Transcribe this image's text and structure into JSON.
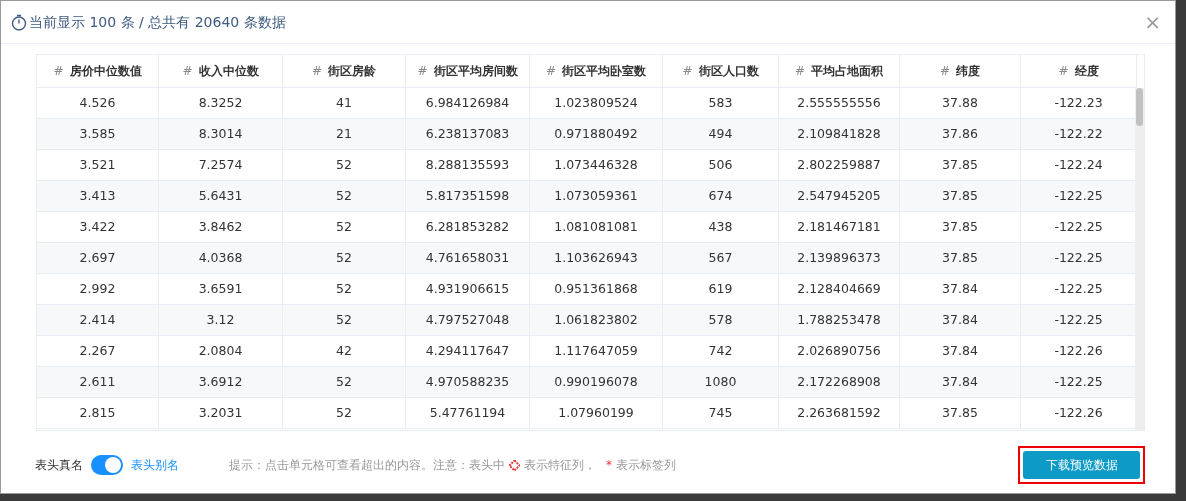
{
  "dialog": {
    "title": "当前显示 100 条 / 总共有 20640 条数据",
    "close": "×"
  },
  "table": {
    "columns": [
      {
        "mark": "#",
        "label": "房价中位数值"
      },
      {
        "mark": "#",
        "label": "收入中位数"
      },
      {
        "mark": "#",
        "label": "街区房龄"
      },
      {
        "mark": "#",
        "label": "街区平均房间数"
      },
      {
        "mark": "#",
        "label": "街区平均卧室数"
      },
      {
        "mark": "#",
        "label": "街区人口数"
      },
      {
        "mark": "#",
        "label": "平均占地面积"
      },
      {
        "mark": "#",
        "label": "纬度"
      },
      {
        "mark": "#",
        "label": "经度"
      }
    ],
    "rows": [
      [
        "4.526",
        "8.3252",
        "41",
        "6.984126984",
        "1.023809524",
        "583",
        "2.555555556",
        "37.88",
        "-122.23"
      ],
      [
        "3.585",
        "8.3014",
        "21",
        "6.238137083",
        "0.971880492",
        "494",
        "2.109841828",
        "37.86",
        "-122.22"
      ],
      [
        "3.521",
        "7.2574",
        "52",
        "8.288135593",
        "1.073446328",
        "506",
        "2.802259887",
        "37.85",
        "-122.24"
      ],
      [
        "3.413",
        "5.6431",
        "52",
        "5.817351598",
        "1.073059361",
        "674",
        "2.547945205",
        "37.85",
        "-122.25"
      ],
      [
        "3.422",
        "3.8462",
        "52",
        "6.281853282",
        "1.081081081",
        "438",
        "2.181467181",
        "37.85",
        "-122.25"
      ],
      [
        "2.697",
        "4.0368",
        "52",
        "4.761658031",
        "1.103626943",
        "567",
        "2.139896373",
        "37.85",
        "-122.25"
      ],
      [
        "2.992",
        "3.6591",
        "52",
        "4.931906615",
        "0.951361868",
        "619",
        "2.128404669",
        "37.84",
        "-122.25"
      ],
      [
        "2.414",
        "3.12",
        "52",
        "4.797527048",
        "1.061823802",
        "578",
        "1.788253478",
        "37.84",
        "-122.25"
      ],
      [
        "2.267",
        "2.0804",
        "42",
        "4.294117647",
        "1.117647059",
        "742",
        "2.026890756",
        "37.84",
        "-122.26"
      ],
      [
        "2.611",
        "3.6912",
        "52",
        "4.970588235",
        "0.990196078",
        "1080",
        "2.172268908",
        "37.84",
        "-122.25"
      ],
      [
        "2.815",
        "3.2031",
        "52",
        "5.47761194",
        "1.07960199",
        "745",
        "2.263681592",
        "37.85",
        "-122.26"
      ]
    ]
  },
  "footer": {
    "switch": {
      "left_label": "表头真名",
      "right_label": "表头别名",
      "on": true
    },
    "hint": {
      "prefix": "提示：点击单元格可查看超出的内容。注意：表头中",
      "feature_text": "表示特征列，",
      "label_mark": "*",
      "label_text": "表示标签列"
    },
    "download_button": {
      "label": "下载预览数据",
      "highlighted": true
    }
  }
}
